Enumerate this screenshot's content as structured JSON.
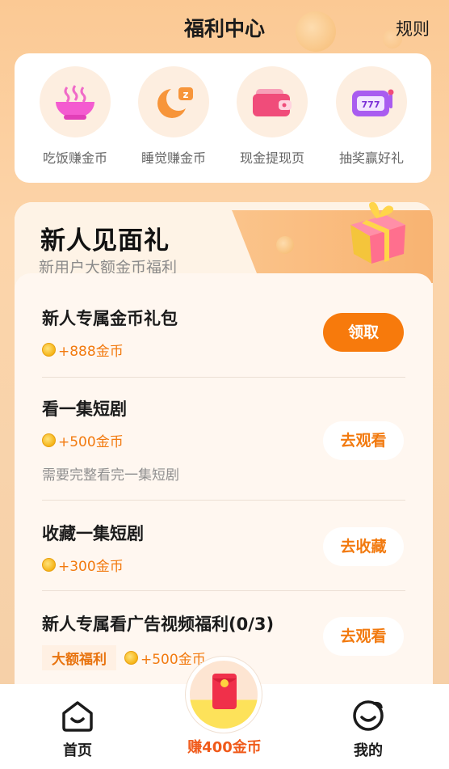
{
  "header": {
    "title": "福利中心",
    "rules_label": "规则"
  },
  "shortcuts": [
    {
      "label": "吃饭赚金币",
      "icon": "bowl-icon"
    },
    {
      "label": "睡觉赚金币",
      "icon": "moon-sleep-icon"
    },
    {
      "label": "现金提现页",
      "icon": "wallet-icon"
    },
    {
      "label": "抽奖赢好礼",
      "icon": "slot-machine-icon",
      "icon_text": "777"
    }
  ],
  "welcome": {
    "title": "新人见面礼",
    "subtitle": "新用户大额金币福利",
    "tasks": [
      {
        "name": "新人专属金币礼包",
        "reward": "+888金币",
        "button": "领取"
      },
      {
        "name": "看一集短剧",
        "reward": "+500金币",
        "note": "需要完整看完一集短剧",
        "button": "去观看"
      },
      {
        "name": "收藏一集短剧",
        "reward": "+300金币",
        "button": "去收藏"
      },
      {
        "name": "新人专属看广告视频福利(0/3)",
        "tag": "大额福利",
        "reward": "+500金币",
        "button": "去观看"
      }
    ]
  },
  "tabbar": {
    "home_label": "首页",
    "earn_label": "赚400金币",
    "mine_label": "我的"
  },
  "colors": {
    "accent": "#f77a0c",
    "reward_text": "#f27a0f",
    "earn_label": "#f05a1a"
  }
}
